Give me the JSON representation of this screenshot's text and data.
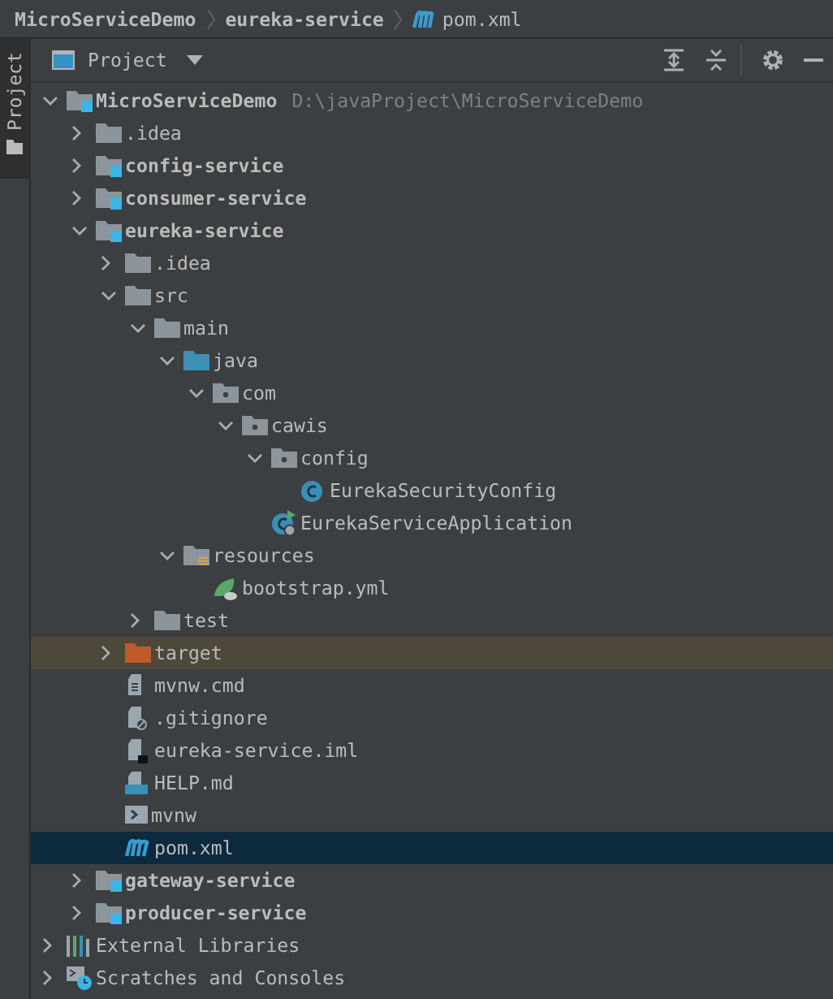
{
  "breadcrumb": [
    {
      "label": "MicroServiceDemo",
      "kind": "folder"
    },
    {
      "label": "eureka-service",
      "kind": "folder"
    },
    {
      "label": "pom.xml",
      "kind": "maven"
    }
  ],
  "side_tab": {
    "label": "Project",
    "selected": true
  },
  "toolbar": {
    "view": "Project"
  },
  "tree": [
    {
      "label": "MicroServiceDemo",
      "kind": "module",
      "path": "D:\\javaProject\\MicroServiceDemo",
      "expanded": true,
      "selected": false,
      "children": [
        {
          "label": ".idea",
          "kind": "folder",
          "expanded": false,
          "selected": false
        },
        {
          "label": "config-service",
          "kind": "module",
          "expanded": false,
          "selected": false
        },
        {
          "label": "consumer-service",
          "kind": "module",
          "expanded": false,
          "selected": false
        },
        {
          "label": "eureka-service",
          "kind": "module",
          "expanded": true,
          "selected": false,
          "children": [
            {
              "label": ".idea",
              "kind": "folder",
              "expanded": false,
              "selected": false
            },
            {
              "label": "src",
              "kind": "folder",
              "expanded": true,
              "selected": false,
              "children": [
                {
                  "label": "main",
                  "kind": "folder",
                  "expanded": true,
                  "selected": false,
                  "children": [
                    {
                      "label": "java",
                      "kind": "source",
                      "expanded": true,
                      "selected": false,
                      "children": [
                        {
                          "label": "com",
                          "kind": "package",
                          "expanded": true,
                          "selected": false,
                          "children": [
                            {
                              "label": "cawis",
                              "kind": "package",
                              "expanded": true,
                              "selected": false,
                              "children": [
                                {
                                  "label": "config",
                                  "kind": "package",
                                  "expanded": true,
                                  "selected": false,
                                  "children": [
                                    {
                                      "label": "EurekaSecurityConfig",
                                      "kind": "class",
                                      "selected": false
                                    }
                                  ]
                                },
                                {
                                  "label": "EurekaServiceApplication",
                                  "kind": "app",
                                  "selected": false
                                }
                              ]
                            }
                          ]
                        }
                      ]
                    },
                    {
                      "label": "resources",
                      "kind": "resources",
                      "expanded": true,
                      "selected": false,
                      "children": [
                        {
                          "label": "bootstrap.yml",
                          "kind": "yml",
                          "selected": false
                        }
                      ]
                    }
                  ]
                },
                {
                  "label": "test",
                  "kind": "folder",
                  "expanded": false,
                  "selected": false
                }
              ]
            },
            {
              "label": "target",
              "kind": "excluded",
              "expanded": false,
              "selected": false
            },
            {
              "label": "mvnw.cmd",
              "kind": "text",
              "selected": false
            },
            {
              "label": ".gitignore",
              "kind": "ignore",
              "selected": false
            },
            {
              "label": "eureka-service.iml",
              "kind": "iml",
              "selected": false
            },
            {
              "label": "HELP.md",
              "kind": "md",
              "selected": false
            },
            {
              "label": "mvnw",
              "kind": "script",
              "selected": false
            },
            {
              "label": "pom.xml",
              "kind": "maven",
              "selected": true
            }
          ]
        },
        {
          "label": "gateway-service",
          "kind": "module",
          "expanded": false,
          "selected": false
        },
        {
          "label": "producer-service",
          "kind": "module",
          "expanded": false,
          "selected": false
        }
      ]
    },
    {
      "label": "External Libraries",
      "kind": "libraries",
      "expanded": false,
      "selected": false
    },
    {
      "label": "Scratches and Consoles",
      "kind": "scratches",
      "expanded": false,
      "selected": false
    }
  ]
}
